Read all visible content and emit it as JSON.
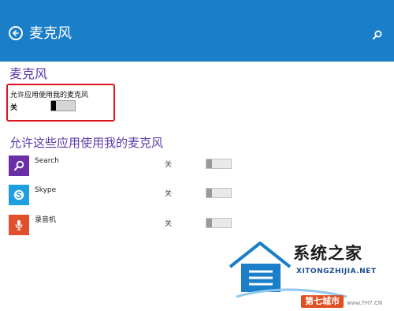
{
  "header": {
    "title": "麦克风",
    "background": "#1a7ec9"
  },
  "section": {
    "title": "麦克风"
  },
  "master": {
    "label": "允许应用使用我的麦克风",
    "state": "关"
  },
  "list": {
    "title": "允许这些应用使用我的麦克风"
  },
  "apps": [
    {
      "name": "Search",
      "state": "关",
      "icon": "search-icon",
      "color": "#6a2fa5"
    },
    {
      "name": "Skype",
      "state": "关",
      "icon": "skype-icon",
      "color": "#1ea0e0"
    },
    {
      "name": "录音机",
      "state": "关",
      "icon": "microphone-icon",
      "color": "#e0502a"
    }
  ],
  "accent_color": "#5b3aa8",
  "highlight_color": "#e0141e",
  "watermark": {
    "text": "系统之家",
    "url": "XITONGZHIJIA.NET",
    "badge": "第七城市",
    "domain": "www.TH7.CN"
  }
}
